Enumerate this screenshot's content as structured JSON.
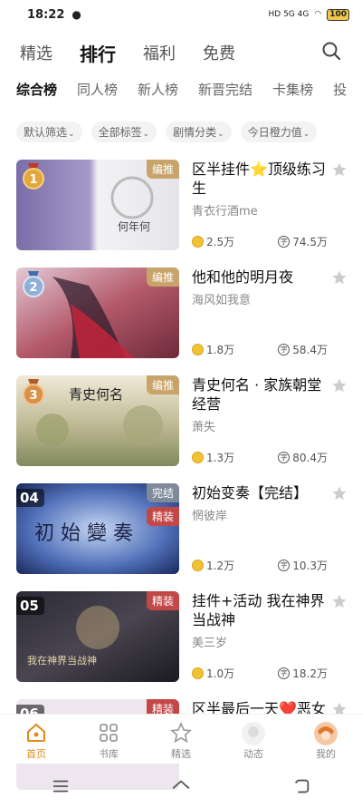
{
  "status": {
    "time": "18:22",
    "network": "HD 5G 4G",
    "battery": "100"
  },
  "topnav": {
    "tabs": [
      "精选",
      "排行",
      "福利",
      "免费"
    ],
    "active": 1
  },
  "subtabs": [
    "综合榜",
    "同人榜",
    "新人榜",
    "新晋完结",
    "卡集榜",
    "投"
  ],
  "filters": [
    "默认筛选",
    "全部标签",
    "剧情分类",
    "今日橙力值"
  ],
  "items": [
    {
      "rank": "1",
      "title": "区半挂件⭐顶级练习生",
      "author": "青衣行酒me",
      "tags": [
        "编推"
      ],
      "coins": "2.5万",
      "yuan": "74.5万"
    },
    {
      "rank": "2",
      "title": "他和他的明月夜",
      "author": "海风如我意",
      "tags": [
        "编推"
      ],
      "coins": "1.8万",
      "yuan": "58.4万"
    },
    {
      "rank": "3",
      "title": "青史何名 · 家族朝堂经营",
      "author": "萧失",
      "tags": [
        "编推"
      ],
      "coins": "1.3万",
      "yuan": "80.4万"
    },
    {
      "rank": "04",
      "title": "初始变奏【完结】",
      "author": "惘彼岸",
      "tags": [
        "完结",
        "精装"
      ],
      "coins": "1.2万",
      "yuan": "10.3万"
    },
    {
      "rank": "05",
      "title": "挂件+活动 我在神界当战神",
      "author": "美三岁",
      "tags": [
        "精装"
      ],
      "coins": "1.0万",
      "yuan": "18.2万"
    },
    {
      "rank": "06",
      "title": "区半最后一天❤️恶女",
      "author": "",
      "tags": [
        "精装"
      ],
      "coins": "",
      "yuan": ""
    }
  ],
  "bottomnav": [
    "首页",
    "书库",
    "精选",
    "动态",
    "我的"
  ],
  "colors": {
    "accent": "#e08a1e",
    "gold_tag": "#c9a46a",
    "red_tag": "#c44747"
  }
}
